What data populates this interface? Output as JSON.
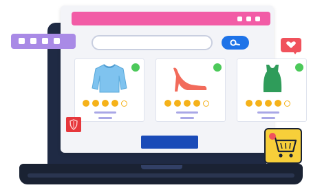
{
  "colors": {
    "title_bar": "#f25ca6",
    "search_button": "#1e73e8",
    "cta_button": "#1a4bb8",
    "float_tab": "#a98ae6",
    "notification": "#f0525c",
    "cart_card": "#f7cf3a",
    "star": "#f5b21a",
    "available": "#4cc95a"
  },
  "products": [
    {
      "item_icon": "sweater-icon",
      "color": "#7fc3ef",
      "rating": 4
    },
    {
      "item_icon": "high-heel-icon",
      "color": "#f26b5b",
      "rating": 4
    },
    {
      "item_icon": "tank-top-icon",
      "color": "#2f9c5a",
      "rating": 4
    }
  ],
  "icons": {
    "search": "search-icon",
    "notification": "comment-heart-icon",
    "cart": "shopping-cart-icon",
    "sale": "shield-icon"
  }
}
